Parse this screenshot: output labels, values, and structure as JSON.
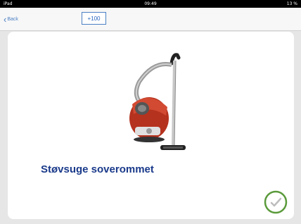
{
  "status_bar": {
    "left": "iPad",
    "time": "09:49",
    "right": "13 %"
  },
  "nav": {
    "back_label": "Back",
    "score": "+100"
  },
  "task": {
    "title": "Støvsuge soverommet",
    "image_icon": "vacuum-cleaner-icon",
    "done_icon": "checkmark-circle-icon"
  },
  "colors": {
    "accent": "#4a7fc4",
    "title": "#1a3a8a",
    "done_ring": "#5a9a3a",
    "vacuum_body": "#b5321e"
  }
}
